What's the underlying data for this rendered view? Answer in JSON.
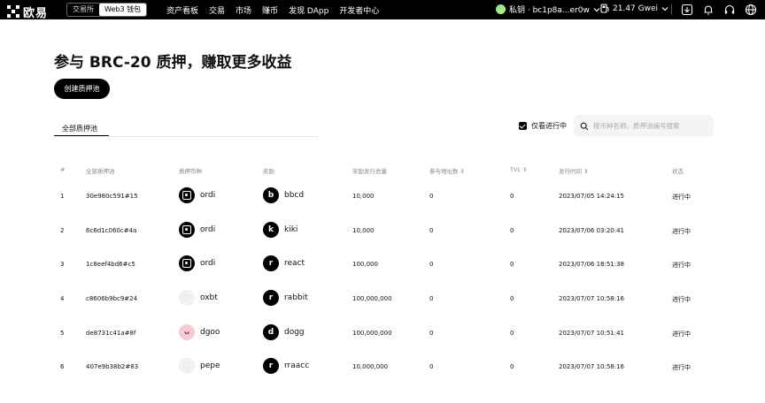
{
  "header": {
    "logo_text": "欧易",
    "switch": [
      "交易所",
      "Web3 钱包"
    ],
    "nav": [
      "资产看板",
      "交易",
      "市场",
      "赚币",
      "发现 DApp",
      "开发者中心"
    ],
    "wallet_label": "私钥 · bc1p8a...er0w",
    "gas_label": "21.47 Gwei"
  },
  "main": {
    "title": "参与 BRC-20 质押，赚取更多收益",
    "create_button": "创建质押池",
    "tab_all": "全部质押池",
    "filter_label": "仅看进行中",
    "search_placeholder": "按币种名称、质押池编号搜索"
  },
  "table": {
    "headers": [
      "#",
      "全部质押池",
      "质押币种",
      "奖励",
      "奖励发行总量",
      "参与地址数 ⇕",
      "TVL ⇕",
      "发行时间 ⇕",
      "状态"
    ],
    "rows": [
      {
        "num": "1",
        "pool": "30e980c591#15",
        "stake": "ordi",
        "stake_icon": "ordi",
        "reward": "bbcd",
        "reward_letter": "b",
        "total": "10,000",
        "addresses": "0",
        "tvl": "0",
        "time": "2023/07/05 14:24:15",
        "status": "进行中"
      },
      {
        "num": "2",
        "pool": "6c6d1c060c#4a",
        "stake": "ordi",
        "stake_icon": "ordi",
        "reward": "kiki",
        "reward_letter": "k",
        "total": "10,000",
        "addresses": "0",
        "tvl": "0",
        "time": "2023/07/06 03:20:41",
        "status": "进行中"
      },
      {
        "num": "3",
        "pool": "1c8eef4bd6#c5",
        "stake": "ordi",
        "stake_icon": "ordi",
        "reward": "react",
        "reward_letter": "r",
        "total": "100,000",
        "addresses": "0",
        "tvl": "0",
        "time": "2023/07/06 18:51:38",
        "status": "进行中"
      },
      {
        "num": "4",
        "pool": "c8606b9bc9#24",
        "stake": "oxbt",
        "stake_icon": "light",
        "reward": "rabbit",
        "reward_letter": "r",
        "total": "100,000,000",
        "addresses": "0",
        "tvl": "0",
        "time": "2023/07/07 10:58:16",
        "status": "进行中"
      },
      {
        "num": "5",
        "pool": "de8731c41a#8f",
        "stake": "dgoo",
        "stake_icon": "pink",
        "reward": "dogg",
        "reward_letter": "d",
        "total": "100,000,000",
        "addresses": "0",
        "tvl": "0",
        "time": "2023/07/07 10:51:41",
        "status": "进行中"
      },
      {
        "num": "6",
        "pool": "407e9b38b2#83",
        "stake": "pepe",
        "stake_icon": "light",
        "reward": "rraacc",
        "reward_letter": "r",
        "total": "10,000,000",
        "addresses": "0",
        "tvl": "0",
        "time": "2023/07/07 10:58:16",
        "status": "进行中"
      }
    ]
  },
  "colors": {
    "accent": "#000000",
    "muted": "#888888",
    "search_bg": "#f4f4f4"
  }
}
